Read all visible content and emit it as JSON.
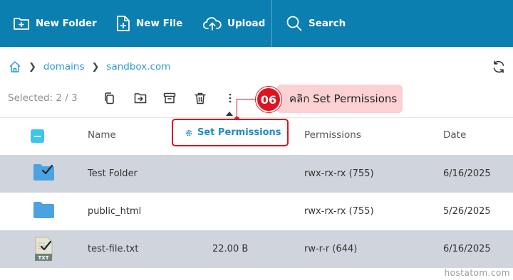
{
  "toolbar": {
    "new_folder": "New Folder",
    "new_file": "New File",
    "upload": "Upload",
    "search": "Search",
    "bg_color": "#0b7fb0"
  },
  "breadcrumb": {
    "items": [
      "domains",
      "sandbox.com"
    ]
  },
  "selection": {
    "label": "Selected: 2 / 3"
  },
  "annotation": {
    "step": "06",
    "text": "คลิก Set Permissions"
  },
  "dropdown": {
    "item": "Set Permissions"
  },
  "table": {
    "headers": {
      "name": "Name",
      "permissions": "Permissions",
      "date": "Date"
    },
    "rows": [
      {
        "name": "Test Folder",
        "size": "",
        "permissions": "rwx-rx-rx (755)",
        "date": "6/16/2025",
        "selected": true,
        "icon": "folder-checked"
      },
      {
        "name": "public_html",
        "size": "",
        "permissions": "rwx-rx-rx (755)",
        "date": "5/26/2025",
        "selected": false,
        "icon": "folder"
      },
      {
        "name": "test-file.txt",
        "size": "22.00 B",
        "permissions": "rw-r-r (644)",
        "date": "6/16/2025",
        "selected": true,
        "icon": "txt-file-checked"
      }
    ]
  },
  "watermark": "hostatom.com"
}
